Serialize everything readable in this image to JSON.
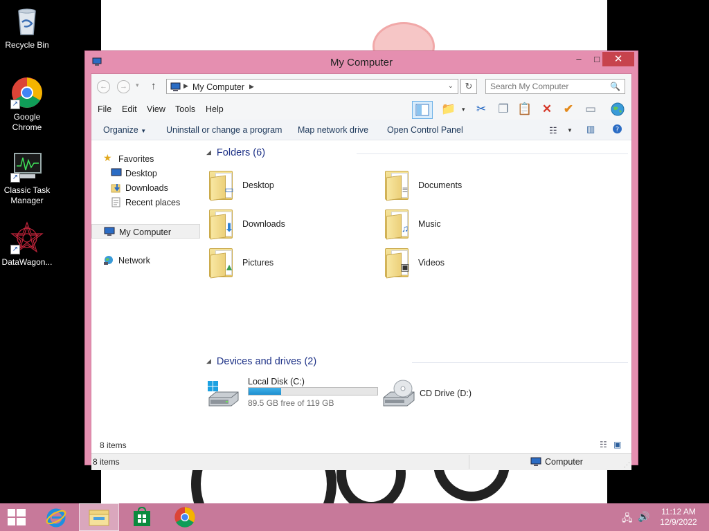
{
  "desktop": {
    "icons": [
      {
        "label": "Recycle Bin",
        "icon": "recycle-bin-icon"
      },
      {
        "label": "Google Chrome",
        "icon": "chrome-icon"
      },
      {
        "label": "Classic Task Manager",
        "icon": "task-manager-icon"
      },
      {
        "label": "DataWagon...",
        "icon": "datawagon-icon"
      }
    ]
  },
  "window": {
    "title": "My Computer",
    "controls": {
      "minimize": "–",
      "maximize": "□",
      "close": "✕"
    }
  },
  "address_bar": {
    "path": "My Computer",
    "search_placeholder": "Search My Computer"
  },
  "menu": [
    "File",
    "Edit",
    "View",
    "Tools",
    "Help"
  ],
  "commands": [
    "Organize",
    "Uninstall or change a program",
    "Map network drive",
    "Open Control Panel"
  ],
  "nav": {
    "favorites": "Favorites",
    "favorites_items": [
      "Desktop",
      "Downloads",
      "Recent places"
    ],
    "computer": "My Computer",
    "network": "Network"
  },
  "folders_group": {
    "heading": "Folders (6)",
    "items": [
      "Desktop",
      "Documents",
      "Downloads",
      "Music",
      "Pictures",
      "Videos"
    ]
  },
  "drives_group": {
    "heading": "Devices and drives (2)",
    "local_disk": {
      "name": "Local Disk (C:)",
      "free_text": "89.5 GB free of 119 GB",
      "used_fraction": 0.25
    },
    "cd_drive": {
      "name": "CD Drive (D:)"
    }
  },
  "footer": {
    "items_count": "8 items"
  },
  "status_bar": {
    "items_count": "8 items",
    "location": "Computer"
  },
  "taskbar": {
    "time": "11:12 AM",
    "date": "12/9/2022"
  },
  "colors": {
    "window_frame": "#e58fb0",
    "taskbar": "#c7799a",
    "close_button": "#c7434d",
    "drive_bar": "#26a0da"
  }
}
